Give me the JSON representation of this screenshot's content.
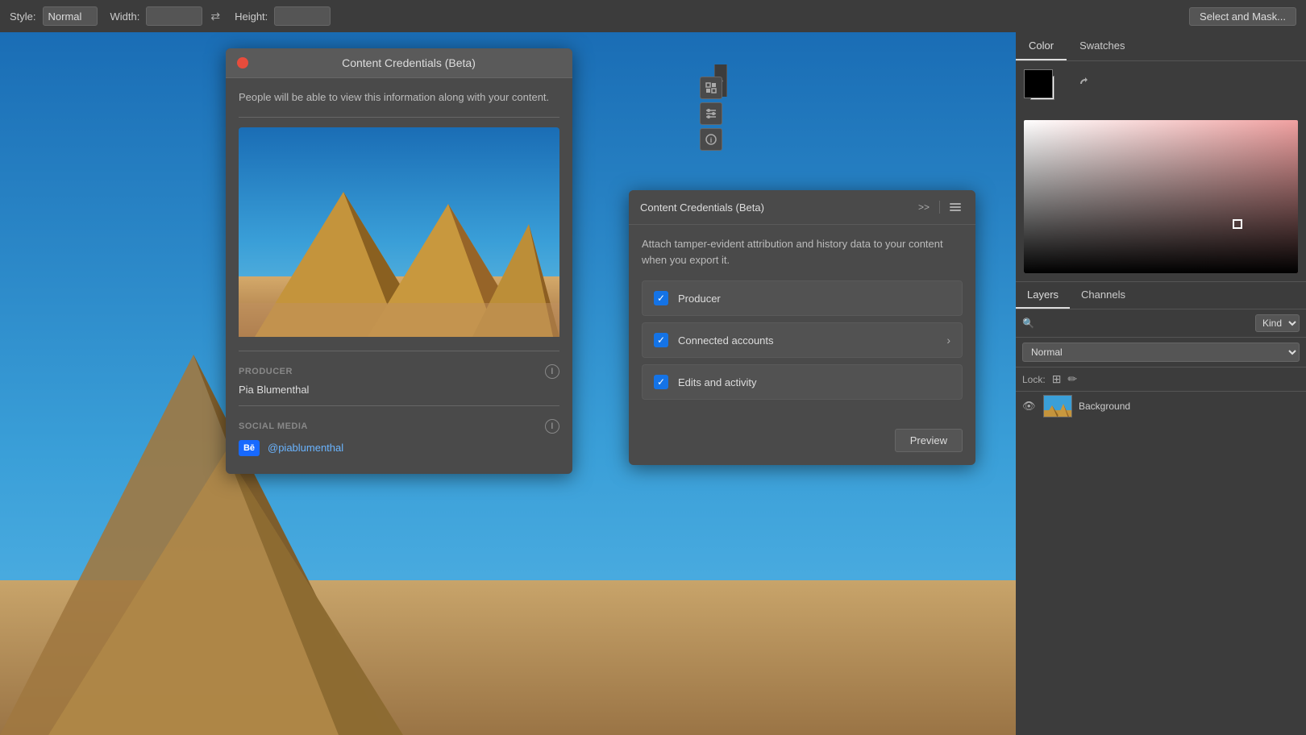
{
  "toolbar": {
    "style_label": "Style:",
    "style_value": "Normal",
    "width_label": "Width:",
    "height_label": "Height:",
    "select_mask_btn": "Select and Mask..."
  },
  "cc_left_panel": {
    "title": "Content Credentials (Beta)",
    "description": "People will be able to view this information along with your content.",
    "producer_label": "PRODUCER",
    "producer_value": "Pia Blumenthal",
    "social_media_label": "SOCIAL MEDIA",
    "social_handle": "@piablumenthal"
  },
  "cc_right_panel": {
    "title": "Content Credentials (Beta)",
    "expand_label": ">>",
    "description": "Attach tamper-evident attribution and history data to your content when you export it.",
    "checkboxes": [
      {
        "label": "Producer",
        "checked": true
      },
      {
        "label": "Connected accounts",
        "checked": true,
        "has_chevron": true
      },
      {
        "label": "Edits and activity",
        "checked": true
      }
    ],
    "preview_btn": "Preview"
  },
  "right_sidebar": {
    "color_tab": "Color",
    "swatches_tab": "Swatches",
    "layers_tab": "Layers",
    "channels_tab": "Channels",
    "kind_label": "Kind",
    "normal_label": "Normal",
    "lock_label": "Lock:",
    "layer_name": "Background"
  },
  "icons": {
    "close": "●",
    "swap": "⇄",
    "search": "🔍",
    "eye": "👁",
    "lock_squares": "⊞",
    "lock_paint": "✏",
    "chevron_right": "›",
    "checkmark": "✓",
    "menu_lines": "≡",
    "info": "i",
    "be_logo": "Bē"
  }
}
